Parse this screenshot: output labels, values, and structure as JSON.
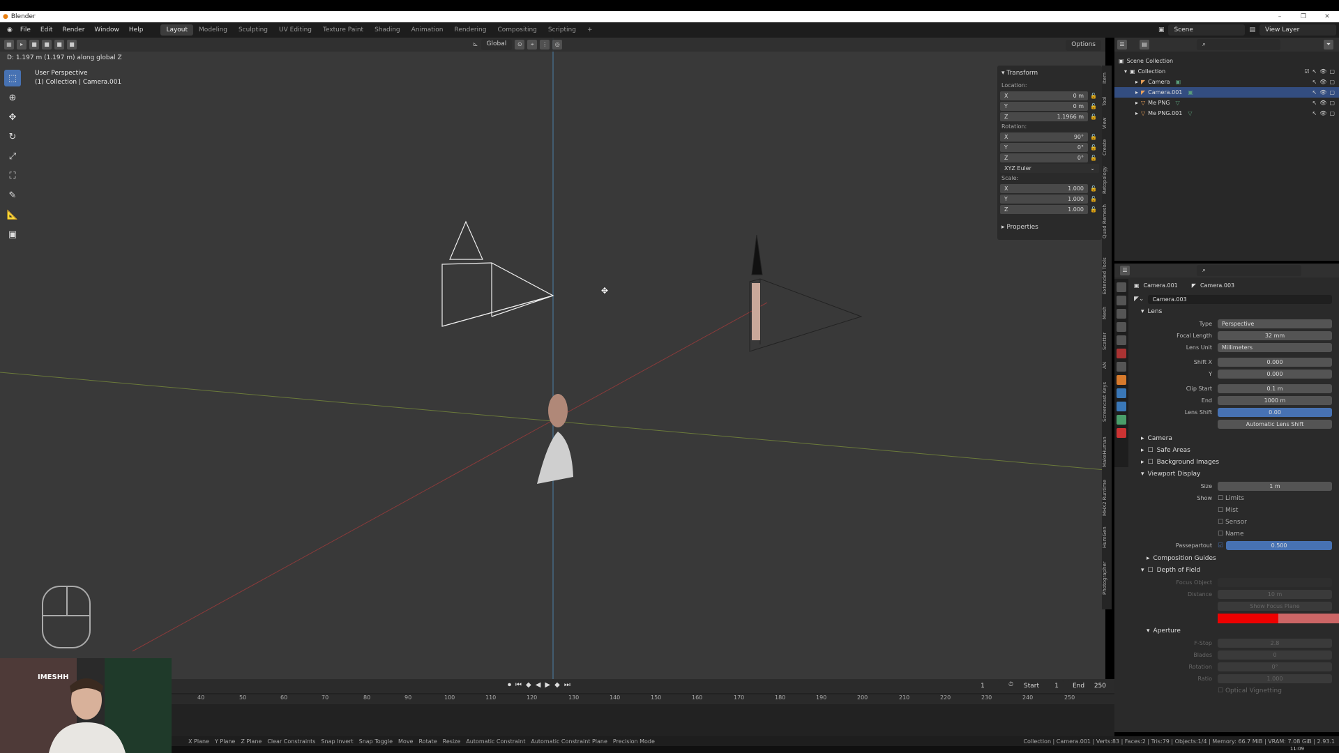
{
  "window": {
    "app_name": "Blender"
  },
  "menu": [
    "File",
    "Edit",
    "Render",
    "Window",
    "Help"
  ],
  "workspaces": [
    "Layout",
    "Modeling",
    "Sculpting",
    "UV Editing",
    "Texture Paint",
    "Shading",
    "Animation",
    "Rendering",
    "Compositing",
    "Scripting",
    "+"
  ],
  "topright": {
    "scene": "Scene",
    "view_layer": "View Layer"
  },
  "viewport": {
    "header": {
      "orientation": "Global",
      "options": "Options"
    },
    "hint": "D: 1.197 m (1.197 m) along global Z",
    "label_line1": "User Perspective",
    "label_line2": "(1) Collection | Camera.001"
  },
  "npanel": {
    "title": "Transform",
    "location_label": "Location:",
    "location": {
      "x": "0 m",
      "y": "0 m",
      "z": "1.1966 m"
    },
    "rotation_label": "Rotation:",
    "rotation": {
      "x": "90°",
      "y": "0°",
      "z": "0°"
    },
    "rotation_mode": "XYZ Euler",
    "scale_label": "Scale:",
    "scale": {
      "x": "1.000",
      "y": "1.000",
      "z": "1.000"
    },
    "properties": "Properties"
  },
  "side_tabs": [
    "Item",
    "Tool",
    "View",
    "Create",
    "Retopology",
    "Quad Remesh",
    "Extended Tools",
    "Mesh",
    "Scatter",
    "AN",
    "Screencast Keys",
    "MakeHuman",
    "MHX2 Runtime",
    "HumGen",
    "Photographer"
  ],
  "outliner": {
    "scene_collection": "Scene Collection",
    "collection": "Collection",
    "items": [
      "Camera",
      "Camera.001",
      "Me PNG",
      "Me PNG.001"
    ]
  },
  "properties": {
    "object_name": "Camera.001",
    "data_name": "Camera.003",
    "datablock": "Camera.003",
    "lens_section": "Lens",
    "type_label": "Type",
    "type_value": "Perspective",
    "focal_label": "Focal Length",
    "focal_value": "32 mm",
    "lens_unit_label": "Lens Unit",
    "lens_unit_value": "Millimeters",
    "shiftx_label": "Shift X",
    "shiftx_value": "0.000",
    "shifty_label": "Y",
    "shifty_value": "0.000",
    "clip_start_label": "Clip Start",
    "clip_start_value": "0.1 m",
    "clip_end_label": "End",
    "clip_end_value": "1000 m",
    "lens_shift_label": "Lens Shift",
    "lens_shift_value": "0.00",
    "auto_lens_shift": "Automatic Lens Shift",
    "camera_section": "Camera",
    "safe_areas": "Safe Areas",
    "background_images": "Background Images",
    "viewport_display": "Viewport Display",
    "size_label": "Size",
    "size_value": "1 m",
    "show_label": "Show",
    "limits": "Limits",
    "mist": "Mist",
    "sensor": "Sensor",
    "name": "Name",
    "passepartout_label": "Passepartout",
    "passepartout_value": "0.500",
    "composition_guides": "Composition Guides",
    "depth_of_field": "Depth of Field",
    "focus_object_label": "Focus Object",
    "distance_label": "Distance",
    "distance_value": "10 m",
    "show_focus_plane": "Show Focus Plane",
    "aperture": "Aperture",
    "fstop_label": "F-Stop",
    "fstop_value": "2.8",
    "blades_label": "Blades",
    "blades_value": "0",
    "rotation_label": "Rotation",
    "rotation_value": "0°",
    "ratio_label": "Ratio",
    "ratio_value": "1.000",
    "optical_vignetting": "Optical Vignetting"
  },
  "timeline": {
    "current_frame": "1",
    "start_label": "Start",
    "start_value": "1",
    "end_label": "End",
    "end_value": "250",
    "ticks": [
      "40",
      "50",
      "60",
      "70",
      "80",
      "90",
      "100",
      "110",
      "120",
      "130",
      "140",
      "150",
      "160",
      "170",
      "180",
      "190",
      "200",
      "210",
      "220",
      "230",
      "240",
      "250"
    ]
  },
  "status": {
    "items": [
      "X Plane",
      "Y Plane",
      "Z Plane",
      "Clear Constraints",
      "Snap Invert",
      "Snap Toggle",
      "Move",
      "Rotate",
      "Resize",
      "Automatic Constraint",
      "Automatic Constraint Plane",
      "Precision Mode"
    ],
    "right": "Collection | Camera.001 | Verts:83 | Faces:2 | Tris:79 | Objects:1/4 | Memory: 66.7 MiB | VRAM: 7.08 GiB | 2.93.1"
  },
  "webcam": {
    "logo": "IMESHH"
  },
  "taskbar": {
    "time": "11:09"
  },
  "colors": {
    "accent": "#4772b3",
    "selected_row": "#334d80",
    "viewport_bg": "#393939"
  }
}
